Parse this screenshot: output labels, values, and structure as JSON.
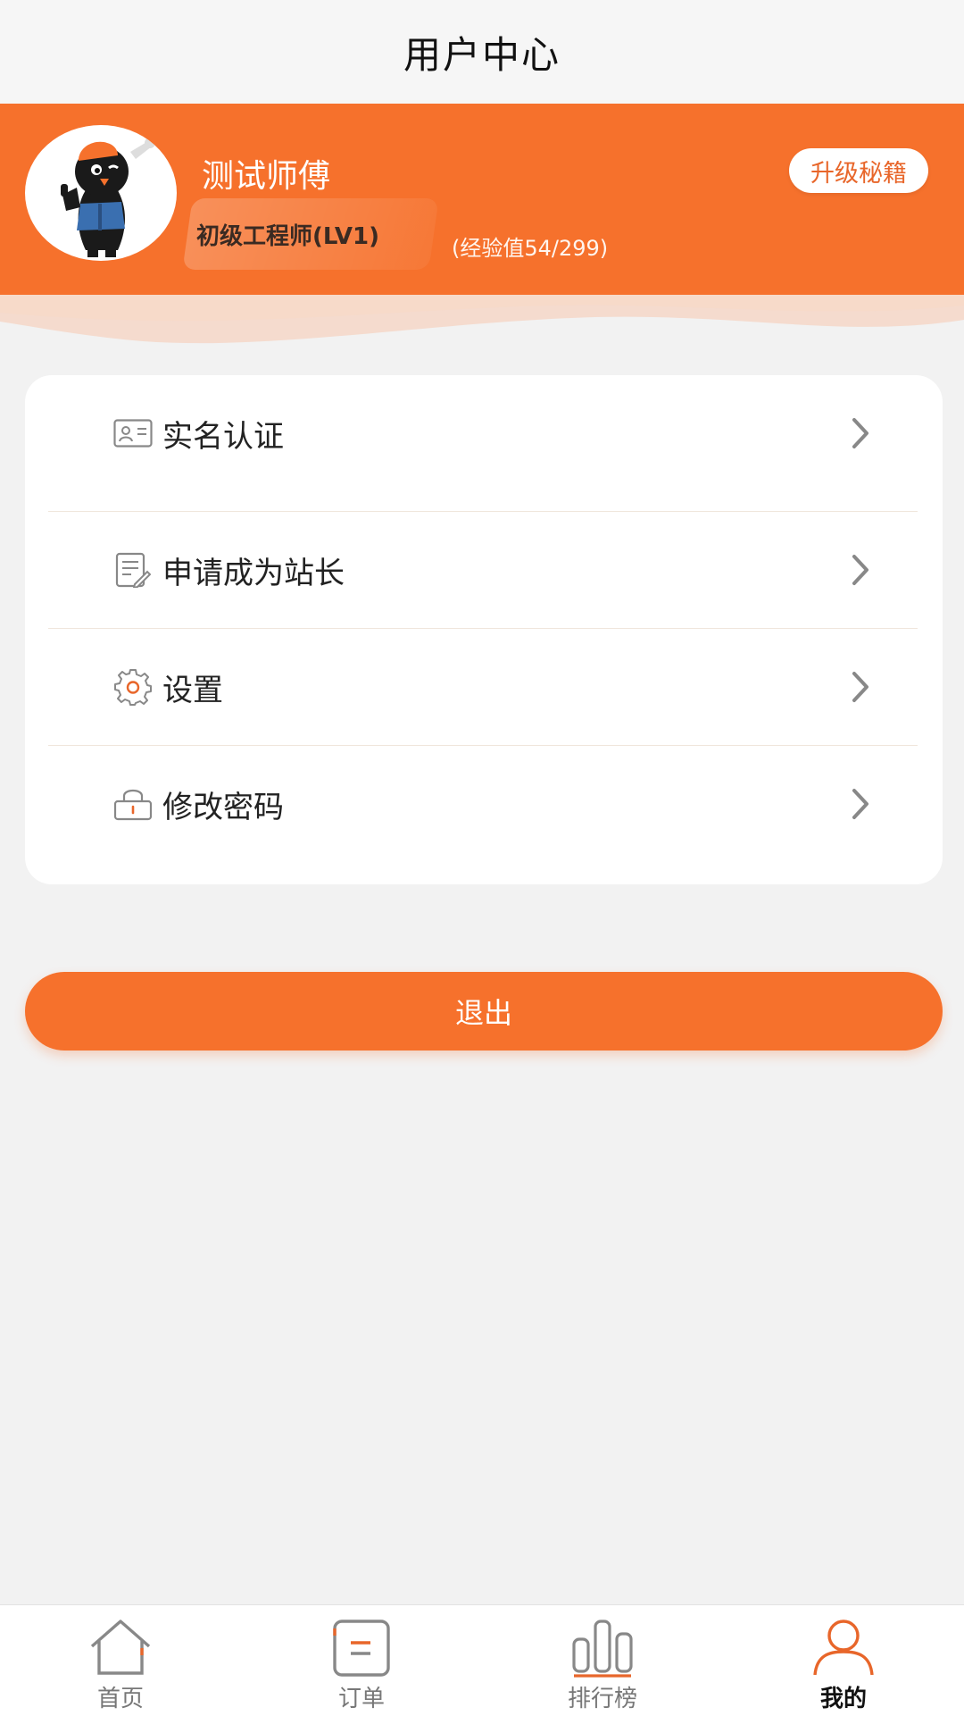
{
  "header": {
    "title": "用户中心"
  },
  "profile": {
    "username": "测试师傅",
    "level": "初级工程师(LV1)",
    "experience": "(经验值54/299)",
    "upgrade_label": "升级秘籍"
  },
  "menu": {
    "items": [
      {
        "label": "实名认证",
        "icon": "id-card-icon"
      },
      {
        "label": "申请成为站长",
        "icon": "edit-document-icon"
      },
      {
        "label": "设置",
        "icon": "gear-icon"
      },
      {
        "label": "修改密码",
        "icon": "lock-icon"
      }
    ]
  },
  "logout_label": "退出",
  "tabbar": {
    "tabs": [
      {
        "label": "首页",
        "icon": "home-icon"
      },
      {
        "label": "订单",
        "icon": "order-icon"
      },
      {
        "label": "排行榜",
        "icon": "ranking-icon"
      },
      {
        "label": "我的",
        "icon": "user-icon",
        "active": true
      }
    ]
  },
  "colors": {
    "accent": "#f6712c",
    "background": "#f2f2f2"
  }
}
